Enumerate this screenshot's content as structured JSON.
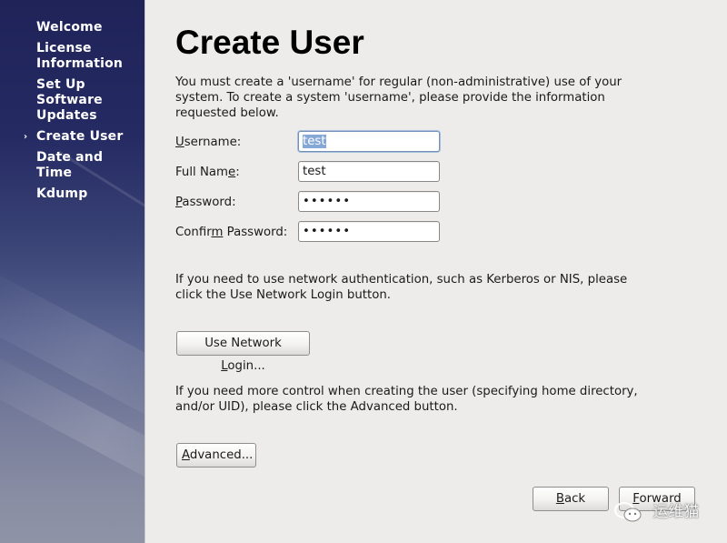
{
  "sidebar": {
    "items": [
      {
        "label": "Welcome",
        "active": false
      },
      {
        "label": "License Information",
        "active": false
      },
      {
        "label": "Set Up Software Updates",
        "active": false
      },
      {
        "label": "Create User",
        "active": true
      },
      {
        "label": "Date and Time",
        "active": false
      },
      {
        "label": "Kdump",
        "active": false
      }
    ],
    "active_marker": "›"
  },
  "main": {
    "title": "Create User",
    "intro": "You must create a 'username' for regular (non-administrative) use of your system.  To create a system 'username', please provide the information requested below.",
    "form": {
      "username": {
        "label_pre": "",
        "label_mnemonic": "U",
        "label_post": "sername:",
        "value": "test"
      },
      "full_name": {
        "label_pre": "Full Nam",
        "label_mnemonic": "e",
        "label_post": ":",
        "value": "test"
      },
      "password": {
        "label_pre": "",
        "label_mnemonic": "P",
        "label_post": "assword:",
        "value": "••••••"
      },
      "confirm_password": {
        "label_pre": "Confir",
        "label_mnemonic": "m",
        "label_post": " Password:",
        "value": "••••••"
      }
    },
    "network_text": "If you need to use network authentication, such as Kerberos or NIS, please click the Use Network Login button.",
    "network_button": {
      "pre": "Use Network ",
      "mnemonic": "L",
      "post": "ogin..."
    },
    "advanced_text": "If you need more control when creating the user (specifying home directory, and/or UID), please click the Advanced button.",
    "advanced_button": {
      "pre": "",
      "mnemonic": "A",
      "post": "dvanced..."
    }
  },
  "footer": {
    "back_button": {
      "pre": "",
      "mnemonic": "B",
      "post": "ack"
    },
    "forward_button": {
      "pre": "",
      "mnemonic": "F",
      "post": "orward"
    }
  },
  "watermark": {
    "text": "运维猫",
    "icon": "wechat-icon"
  },
  "colors": {
    "sidebar_top": "#1f2358",
    "sidebar_bottom": "#8e93a6",
    "background": "#edeceb",
    "selection": "#86a8d6",
    "focus_border": "#7291b8"
  }
}
